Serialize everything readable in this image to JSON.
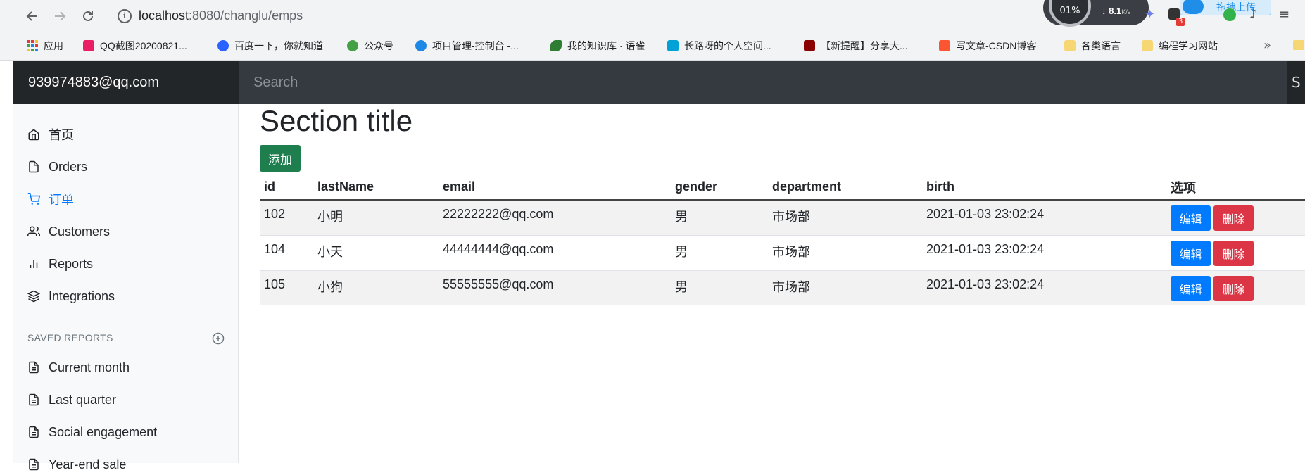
{
  "browser": {
    "url_host": "localhost",
    "url_path": ":8080/changlu/emps",
    "ext_ring_text": "01%",
    "ext_speed": "8.1",
    "ext_speed_unit": "K/s",
    "ext_badge": "3",
    "ext_upload": "拖拽上传",
    "bookmarks_more": "»",
    "bookmarks": [
      {
        "label": "应用",
        "color": "#e53935"
      },
      {
        "label": "QQ截图20200821...",
        "color": "#e91e63"
      },
      {
        "label": "百度一下，你就知道",
        "color": "#2962ff"
      },
      {
        "label": "公众号",
        "color": "#43a047"
      },
      {
        "label": "项目管理-控制台 -...",
        "color": "#1e88e5"
      },
      {
        "label": "我的知识库 · 语雀",
        "color": "#2e7d32"
      },
      {
        "label": "长路呀的个人空间...",
        "color": "#00a1d6"
      },
      {
        "label": "【新提醒】分享大...",
        "color": "#8b0000"
      },
      {
        "label": "写文章-CSDN博客",
        "color": "#fc5531"
      },
      {
        "label": "各类语言",
        "color": "#f7d774"
      },
      {
        "label": "编程学习网站",
        "color": "#f7d774"
      }
    ]
  },
  "navbar": {
    "brand": "939974883@qq.com",
    "search_placeholder": "Search",
    "edge_text": "S"
  },
  "sidebar": {
    "items": [
      {
        "label": "首页",
        "icon": "home-icon"
      },
      {
        "label": "Orders",
        "icon": "file-icon"
      },
      {
        "label": "订单",
        "icon": "shopping-cart-icon",
        "active": true
      },
      {
        "label": "Customers",
        "icon": "users-icon"
      },
      {
        "label": "Reports",
        "icon": "bar-chart-icon"
      },
      {
        "label": "Integrations",
        "icon": "layers-icon"
      }
    ],
    "saved_heading": "SAVED REPORTS",
    "saved_items": [
      {
        "label": "Current month",
        "icon": "file-text-icon"
      },
      {
        "label": "Last quarter",
        "icon": "file-text-icon"
      },
      {
        "label": "Social engagement",
        "icon": "file-text-icon"
      },
      {
        "label": "Year-end sale",
        "icon": "file-text-icon"
      }
    ]
  },
  "main": {
    "title": "Section title",
    "add_label": "添加",
    "columns": [
      "id",
      "lastName",
      "email",
      "gender",
      "department",
      "birth",
      "选项"
    ],
    "edit_label": "编辑",
    "delete_label": "删除",
    "rows": [
      {
        "id": "102",
        "lastName": "小明",
        "email": "22222222@qq.com",
        "gender": "男",
        "department": "市场部",
        "birth": "2021-01-03 23:02:24"
      },
      {
        "id": "104",
        "lastName": "小天",
        "email": "44444444@qq.com",
        "gender": "男",
        "department": "市场部",
        "birth": "2021-01-03 23:02:24"
      },
      {
        "id": "105",
        "lastName": "小狗",
        "email": "55555555@qq.com",
        "gender": "男",
        "department": "市场部",
        "birth": "2021-01-03 23:02:24"
      }
    ]
  }
}
